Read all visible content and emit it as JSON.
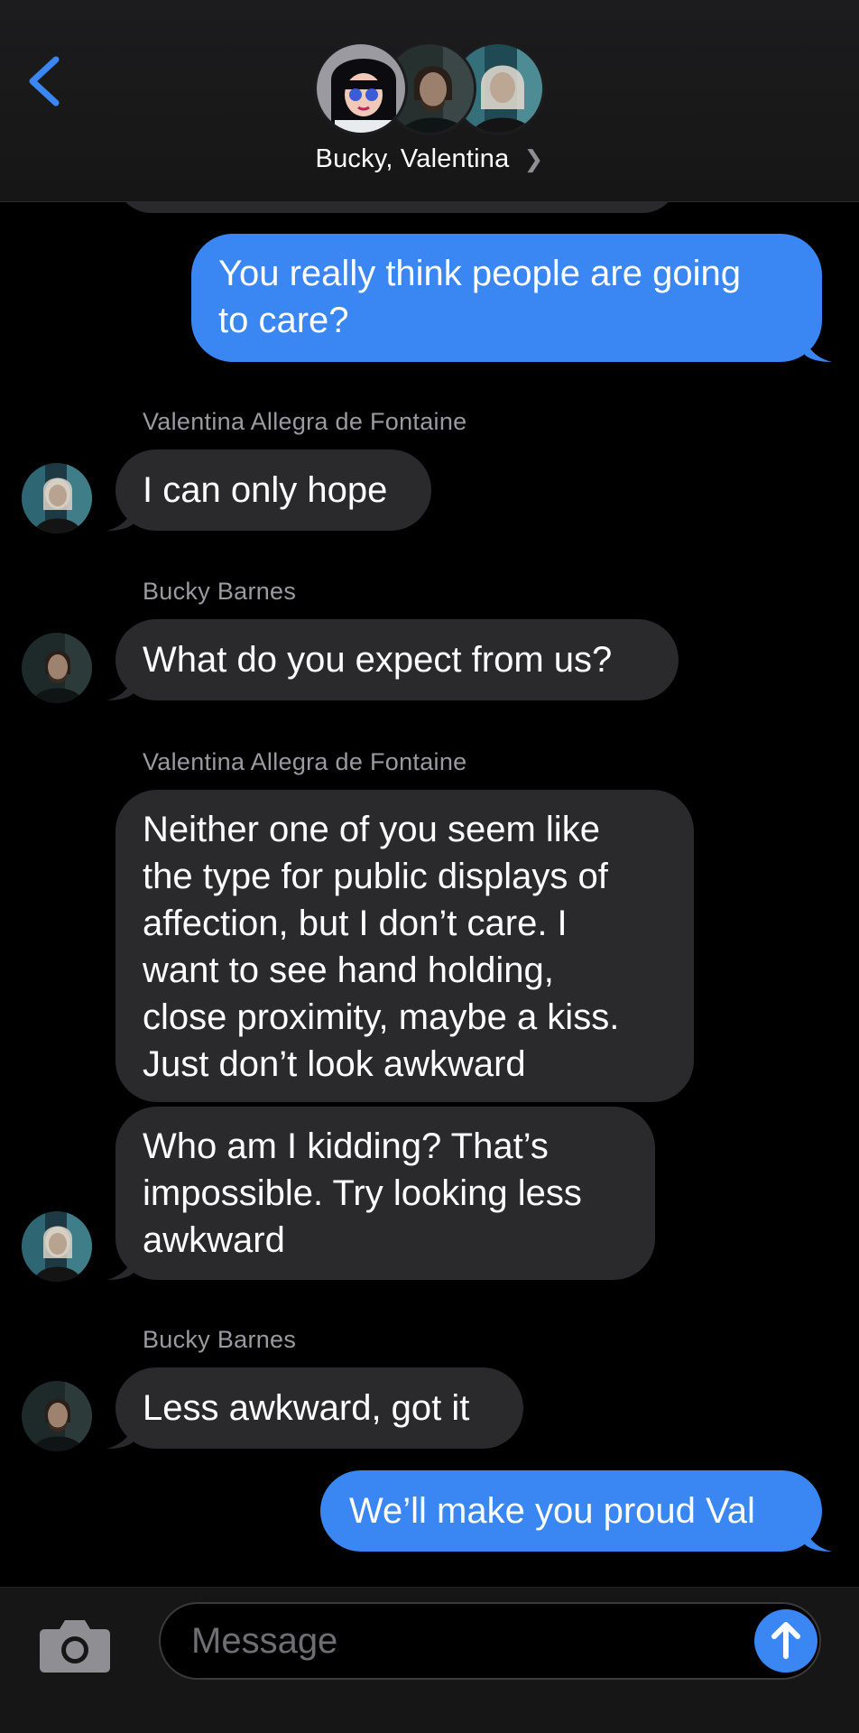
{
  "header": {
    "title": "Bucky, Valentina",
    "back_icon": "chevron-left-icon",
    "disclosure_icon": "chevron-right-icon",
    "accent_color": "#3a86f2"
  },
  "messages": [
    {
      "direction": "outgoing",
      "lines": [
        "You really think people are going",
        "to care?"
      ]
    },
    {
      "direction": "incoming",
      "sender": "Valentina Allegra de Fontaine",
      "lines": [
        "I can only hope"
      ]
    },
    {
      "direction": "incoming",
      "sender": "Bucky Barnes",
      "lines": [
        "What do you expect from us?"
      ]
    },
    {
      "direction": "incoming",
      "sender": "Valentina Allegra de Fontaine",
      "lines": [
        "Neither one of you seem like",
        "the type for public displays of",
        "affection, but I don’t care. I",
        "want to see hand holding,",
        "close proximity, maybe a kiss.",
        "Just don’t look awkward"
      ]
    },
    {
      "direction": "incoming",
      "lines": [
        "Who am I kidding? That’s",
        "impossible. Try looking less",
        "awkward"
      ]
    },
    {
      "direction": "incoming",
      "sender": "Bucky Barnes",
      "lines": [
        "Less awkward, got it"
      ]
    },
    {
      "direction": "outgoing",
      "lines": [
        "We’ll make you proud Val"
      ]
    }
  ],
  "input": {
    "placeholder": "Message",
    "camera_icon": "camera-icon",
    "send_icon": "arrow-up-icon"
  },
  "colors": {
    "incoming_bubble": "#2a2a2d",
    "outgoing_bubble": "#3a86f2",
    "sender_label": "#9a9aa0",
    "background": "#000000"
  }
}
